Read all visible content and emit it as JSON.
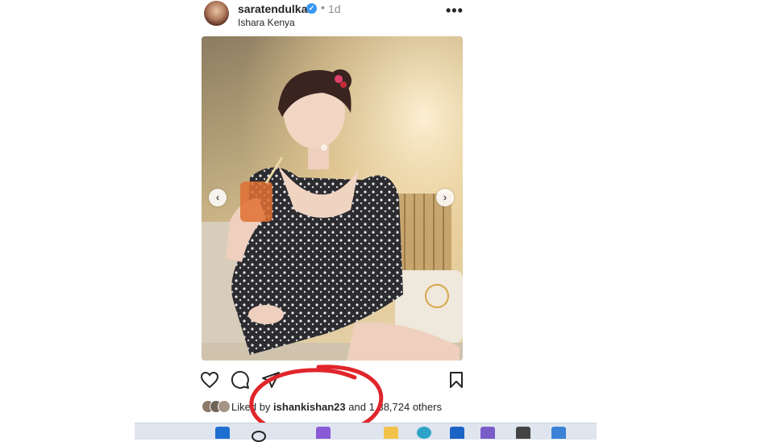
{
  "post": {
    "username": "saratendulkar",
    "separator": "•",
    "time": "1d",
    "location": "Ishara Kenya",
    "more": "•••"
  },
  "likes": {
    "prefix": "Liked by",
    "user": "ishankishan23",
    "middle": "and",
    "count": "1,3",
    "count_rest": "8,724 others"
  },
  "icons": {
    "verified": "verified-check-icon",
    "like": "heart-icon",
    "comment": "comment-bubble-icon",
    "share": "paper-plane-icon",
    "save": "bookmark-icon",
    "prev": "chevron-left-icon",
    "next": "chevron-right-icon"
  },
  "colors": {
    "annotation": "#e0252b",
    "verified": "#3897f0",
    "text": "#262626",
    "muted": "#8e8e8e"
  }
}
